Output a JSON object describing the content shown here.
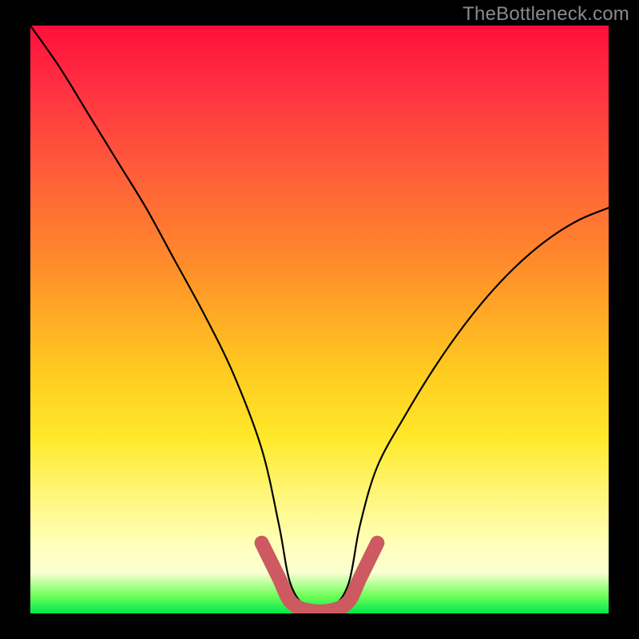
{
  "watermark": "TheBottleneck.com",
  "chart_data": {
    "type": "line",
    "title": "",
    "xlabel": "",
    "ylabel": "",
    "xlim": [
      0,
      100
    ],
    "ylim": [
      0,
      100
    ],
    "series": [
      {
        "name": "curve",
        "x": [
          0,
          5,
          10,
          15,
          20,
          25,
          30,
          35,
          40,
          43,
          45,
          48,
          52,
          55,
          57,
          60,
          65,
          70,
          75,
          80,
          85,
          90,
          95,
          100
        ],
        "values": [
          100,
          93,
          85,
          77,
          69,
          60,
          51,
          41,
          28,
          15,
          5,
          1,
          1,
          5,
          15,
          25,
          34,
          42,
          49,
          55,
          60,
          64,
          67,
          69
        ]
      }
    ],
    "highlight": {
      "name": "bottom-band",
      "x": [
        40,
        43,
        45,
        48,
        52,
        55,
        57,
        60
      ],
      "values": [
        12,
        6,
        2,
        0.5,
        0.5,
        2,
        6,
        12
      ]
    },
    "gradient_stops": [
      {
        "pos": 0,
        "color": "#ff0f3a"
      },
      {
        "pos": 40,
        "color": "#ff8a2b"
      },
      {
        "pos": 70,
        "color": "#ffe82a"
      },
      {
        "pos": 93,
        "color": "#fbffd2"
      },
      {
        "pos": 100,
        "color": "#00e84b"
      }
    ]
  }
}
